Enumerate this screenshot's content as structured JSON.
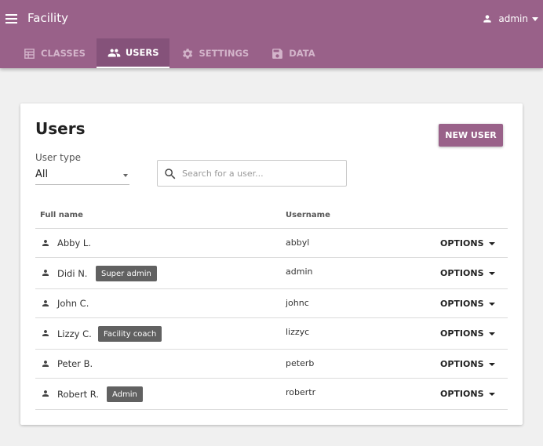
{
  "appbar": {
    "title": "Facility",
    "user_label": "admin"
  },
  "tabs": [
    {
      "label": "CLASSES",
      "icon": "classes-icon",
      "active": false
    },
    {
      "label": "USERS",
      "icon": "people-icon",
      "active": true
    },
    {
      "label": "SETTINGS",
      "icon": "gear-icon",
      "active": false
    },
    {
      "label": "DATA",
      "icon": "save-icon",
      "active": false
    }
  ],
  "page": {
    "title": "Users",
    "new_user_label": "NEW USER",
    "user_type_label": "User type",
    "user_type_value": "All",
    "search_placeholder": "Search for a user..."
  },
  "table": {
    "headers": {
      "fullname": "Full name",
      "username": "Username"
    },
    "options_label": "OPTIONS",
    "rows": [
      {
        "fullname": "Abby L.",
        "badge": "",
        "username": "abbyl"
      },
      {
        "fullname": "Didi N.",
        "badge": "Super admin",
        "username": "admin"
      },
      {
        "fullname": "John C.",
        "badge": "",
        "username": "johnc"
      },
      {
        "fullname": "Lizzy C.",
        "badge": "Facility coach",
        "username": "lizzyc"
      },
      {
        "fullname": "Peter B.",
        "badge": "",
        "username": "peterb"
      },
      {
        "fullname": "Robert R.",
        "badge": "Admin",
        "username": "robertr"
      }
    ]
  },
  "colors": {
    "brand": "#996189",
    "active_tab": "#85527a",
    "badge": "#616161"
  }
}
